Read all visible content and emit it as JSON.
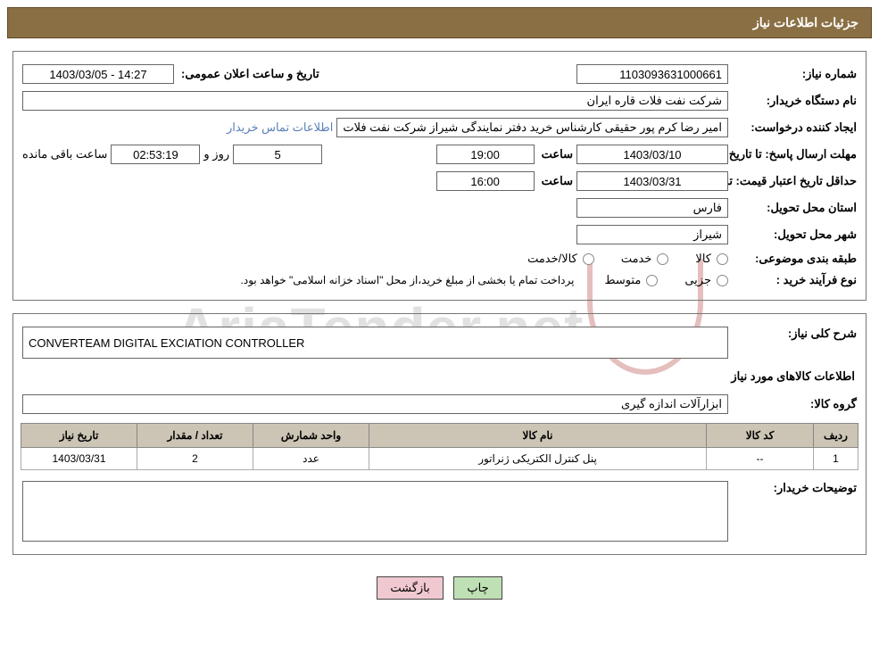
{
  "header": {
    "title": "جزئیات اطلاعات نیاز"
  },
  "fields": {
    "need_no_label": "شماره نیاز:",
    "need_no": "1103093631000661",
    "announce_label": "تاریخ و ساعت اعلان عمومی:",
    "announce": "14:27 - 1403/03/05",
    "buyer_org_label": "نام دستگاه خریدار:",
    "buyer_org": "شرکت نفت فلات قاره ایران",
    "requester_label": "ایجاد کننده درخواست:",
    "requester": "امیر رضا کرم پور حقیقی کارشناس خرید دفتر نمایندگی شیراز شرکت نفت فلات",
    "contact_link": "اطلاعات تماس خریدار",
    "reply_deadline_label": "مهلت ارسال پاسخ: تا تاریخ:",
    "reply_date": "1403/03/10",
    "time_label": "ساعت",
    "reply_time": "19:00",
    "days": "5",
    "days_suffix": "روز و",
    "countdown": "02:53:19",
    "remaining": "ساعت باقی مانده",
    "min_validity_label": "حداقل تاریخ اعتبار قیمت: تا تاریخ:",
    "validity_date": "1403/03/31",
    "validity_time": "16:00",
    "province_label": "استان محل تحویل:",
    "province": "فارس",
    "city_label": "شهر محل تحویل:",
    "city": "شیراز",
    "category_label": "طبقه بندی موضوعی:",
    "cat1": "کالا",
    "cat2": "خدمت",
    "cat3": "کالا/خدمت",
    "purchase_type_label": "نوع فرآیند خرید :",
    "pt1": "جزیی",
    "pt2": "متوسط",
    "purchase_note": "پرداخت تمام یا بخشی از مبلغ خرید،از محل \"اسناد خزانه اسلامی\" خواهد بود.",
    "summary_label": "شرح کلی نیاز:",
    "summary": "CONVERTEAM DIGITAL EXCIATION CONTROLLER",
    "items_section_title": "اطلاعات کالاهای مورد نیاز",
    "group_label": "گروه کالا:",
    "group": "ابزارآلات اندازه گیری",
    "table": {
      "headers": {
        "row": "ردیف",
        "code": "کد کالا",
        "name": "نام کالا",
        "unit": "واحد شمارش",
        "qty": "تعداد / مقدار",
        "need_date": "تاریخ نیاز"
      },
      "rows": [
        {
          "row": "1",
          "code": "--",
          "name": "پنل کنترل الکتریکی ژنراتور",
          "unit": "عدد",
          "qty": "2",
          "need_date": "1403/03/31"
        }
      ]
    },
    "buyer_notes_label": "توضیحات خریدار:"
  },
  "buttons": {
    "print": "چاپ",
    "back": "بازگشت"
  },
  "watermark": {
    "text": "AriaTender.net"
  }
}
